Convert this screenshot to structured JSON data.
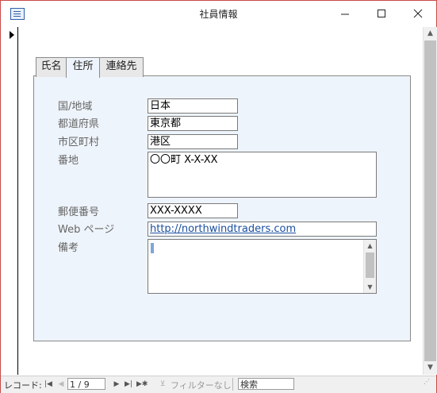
{
  "window": {
    "title": "社員情報"
  },
  "tabs": [
    {
      "label": "氏名"
    },
    {
      "label": "住所"
    },
    {
      "label": "連絡先"
    }
  ],
  "form": {
    "country": {
      "label": "国/地域",
      "value": "日本"
    },
    "prefecture": {
      "label": "都道府県",
      "value": "東京都"
    },
    "city": {
      "label": "市区町村",
      "value": "港区"
    },
    "address": {
      "label": "番地",
      "value": "〇〇町 X-X-XX"
    },
    "postal": {
      "label": "郵便番号",
      "value": "XXX-XXXX"
    },
    "web": {
      "label": "Web ページ",
      "value": "http://northwindtraders.com"
    },
    "notes": {
      "label": "備考",
      "value": ""
    }
  },
  "navbar": {
    "label": "レコード:",
    "record": "1 / 9",
    "filter": "フィルターなし",
    "search": "検索"
  },
  "icons": [
    "app-form-icon",
    "minimize-icon",
    "maximize-icon",
    "close-icon",
    "record-pointer-icon",
    "scroll-up-icon",
    "scroll-down-icon",
    "first-record-icon",
    "previous-record-icon",
    "next-record-icon",
    "last-record-icon",
    "new-record-icon",
    "filter-icon"
  ]
}
